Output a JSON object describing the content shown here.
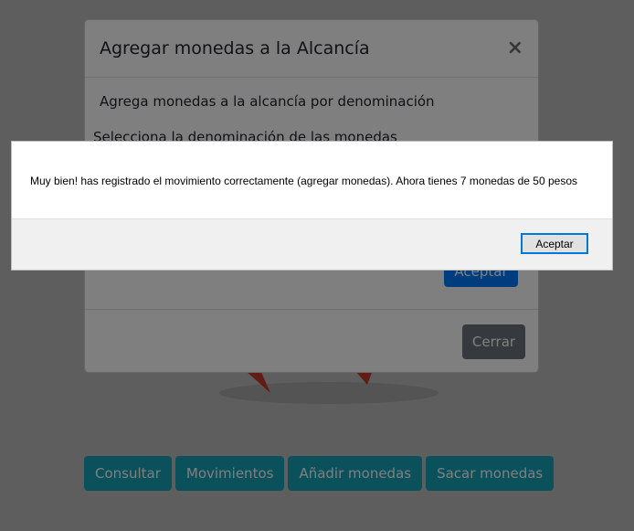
{
  "background": {
    "buttons": [
      "Consultar",
      "Movimientos",
      "Añadir monedas",
      "Sacar monedas"
    ]
  },
  "modal": {
    "title": "Agregar monedas a la Alcancía",
    "close_symbol": "×",
    "description": "Agrega monedas a la alcancía por denominación",
    "denomination_label": "Selecciona la denominación de las monedas",
    "accept_label": "Aceptar",
    "close_label": "Cerrar"
  },
  "alert": {
    "message": "Muy bien! has registrado el movimiento correctamente (agregar monedas). Ahora tienes 7 monedas de 50 pesos",
    "ok_label": "Aceptar"
  },
  "colors": {
    "info": "#17a2b8",
    "primary": "#007bff",
    "secondary": "#6c757d",
    "focus": "#0078d7"
  }
}
